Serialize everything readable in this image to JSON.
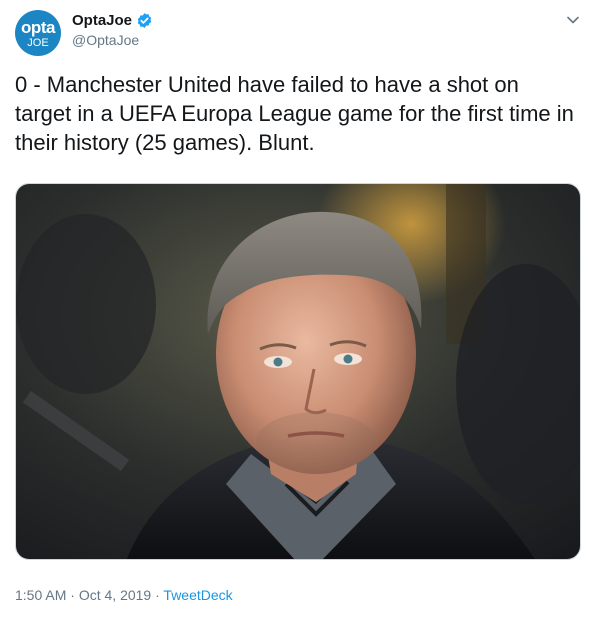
{
  "account": {
    "avatar_line1": "opta",
    "avatar_line2": "JOE",
    "display_name": "OptaJoe",
    "handle": "@OptaJoe",
    "verified": true
  },
  "tweet": {
    "text": "0 - Manchester United have failed to have a shot on target in a UEFA Europa League game for the first time in their history (25 games). Blunt."
  },
  "footer": {
    "time": "1:50 AM",
    "separator1": " · ",
    "date": "Oct 4, 2019",
    "separator2": " · ",
    "source": "TweetDeck"
  },
  "icons": {
    "verified": "verified-badge-icon",
    "menu": "chevron-down-icon"
  },
  "colors": {
    "link": "#1b95e0",
    "verified": "#1da1f2",
    "avatar_bg": "#1b86c3",
    "secondary_text": "#657786"
  }
}
